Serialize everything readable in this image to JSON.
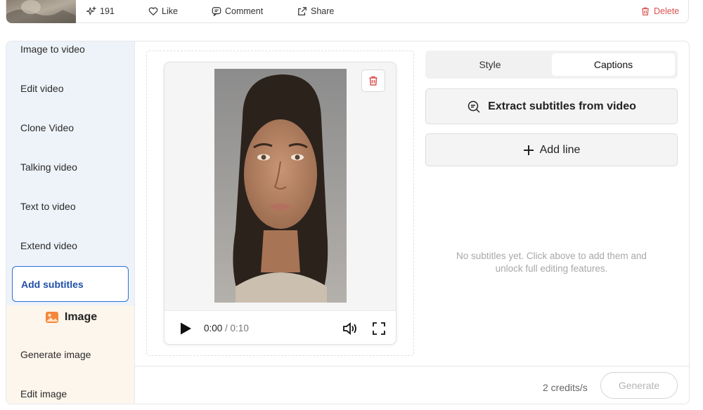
{
  "topbar": {
    "like_count": "191",
    "like_label": "Like",
    "comment_label": "Comment",
    "share_label": "Share",
    "delete_label": "Delete"
  },
  "sidebar": {
    "items": [
      {
        "label": "Image to video"
      },
      {
        "label": "Edit video"
      },
      {
        "label": "Clone Video"
      },
      {
        "label": "Talking video"
      },
      {
        "label": "Text to video"
      },
      {
        "label": "Extend video"
      },
      {
        "label": "Add subtitles"
      }
    ],
    "image_section": {
      "title": "Image",
      "items": [
        {
          "label": "Generate image"
        },
        {
          "label": "Edit image"
        }
      ]
    }
  },
  "player": {
    "current_time": "0:00",
    "separator": " / ",
    "duration": "0:10"
  },
  "captions_panel": {
    "tabs": [
      {
        "label": "Style"
      },
      {
        "label": "Captions"
      }
    ],
    "active_tab": "Captions",
    "extract_label": "Extract subtitles from video",
    "add_line_label": "Add line",
    "empty_message": "No subtitles yet. Click above to add them and unlock full editing features."
  },
  "footer": {
    "credits": "2 credits/s",
    "generate_label": "Generate"
  },
  "colors": {
    "accent": "#2f6fd6",
    "danger": "#d9534f",
    "sidebar_bg": "#eef3f9",
    "image_section_bg": "#fdf6ec"
  }
}
